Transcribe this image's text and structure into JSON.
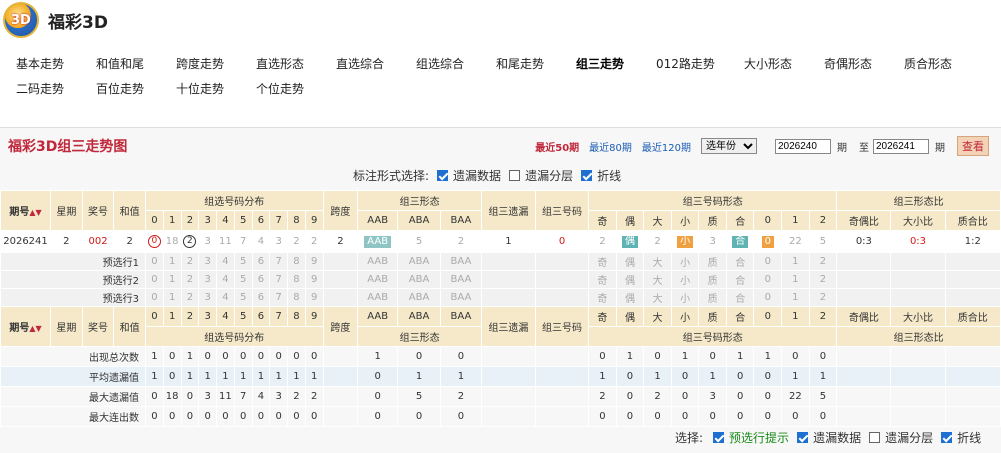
{
  "app": {
    "name": "福彩3D"
  },
  "nav": {
    "row1": [
      "基本走势",
      "和值和尾",
      "跨度走势",
      "直选形态",
      "直选综合",
      "组选综合",
      "和尾走势",
      "组三走势",
      "012路走势",
      "大小形态",
      "奇偶形态",
      "质合形态"
    ],
    "row2": [
      "二码走势",
      "百位走势",
      "十位走势",
      "个位走势"
    ],
    "active": "组三走势"
  },
  "panel": {
    "title": "福彩3D组三走势图",
    "period_links": [
      "最近50期",
      "最近80期",
      "最近120期"
    ],
    "year_select": "选年份",
    "from": "2026240",
    "from_unit": "期",
    "to_label": "至",
    "to": "2026241",
    "to_unit": "期",
    "search": "查看"
  },
  "marking": {
    "label": "标注形式选择:",
    "opts": [
      "遗漏数据",
      "遗漏分层",
      "折线"
    ]
  },
  "headers": {
    "issue": "期号",
    "week": "星期",
    "prize": "奖号",
    "sum": "和值",
    "dist": "组选号码分布",
    "span": "跨度",
    "shape": "组三形态",
    "miss": "组三遗漏",
    "code": "组三号码",
    "numshape": "组三号码形态",
    "ratio": "组三形态比",
    "digits": [
      "0",
      "1",
      "2",
      "3",
      "4",
      "5",
      "6",
      "7",
      "8",
      "9"
    ],
    "shapes": [
      "AAB",
      "ABA",
      "BAA"
    ],
    "numcols": [
      "奇",
      "偶",
      "大",
      "小",
      "质",
      "合",
      "0",
      "1",
      "2"
    ],
    "ratios": [
      "奇偶比",
      "大小比",
      "质合比"
    ]
  },
  "row": {
    "issue": "2026241",
    "week": "2",
    "prize": "002",
    "sum": "2",
    "dist": [
      "0",
      "18",
      "2",
      "3",
      "11",
      "7",
      "4",
      "3",
      "2",
      "2"
    ],
    "span": "2",
    "shape": [
      "AAB",
      "5",
      "2"
    ],
    "miss": "1",
    "code": "0",
    "num": [
      "2",
      "偶",
      "2",
      "小",
      "3",
      "合",
      "0",
      "22",
      "5"
    ],
    "ratios": [
      "0:3",
      "0:3",
      "1:2"
    ]
  },
  "pre": [
    "预选行1",
    "预选行2",
    "预选行3"
  ],
  "stats": [
    {
      "label": "出现总次数",
      "dist": [
        "1",
        "0",
        "1",
        "0",
        "0",
        "0",
        "0",
        "0",
        "0",
        "0"
      ],
      "shape": [
        "1",
        "0",
        "0"
      ],
      "num": [
        "0",
        "1",
        "0",
        "1",
        "0",
        "1",
        "1",
        "0",
        "0"
      ]
    },
    {
      "label": "平均遗漏值",
      "dist": [
        "1",
        "0",
        "1",
        "1",
        "1",
        "1",
        "1",
        "1",
        "1",
        "1"
      ],
      "shape": [
        "0",
        "1",
        "1"
      ],
      "num": [
        "1",
        "0",
        "1",
        "0",
        "1",
        "0",
        "0",
        "1",
        "1"
      ]
    },
    {
      "label": "最大遗漏值",
      "dist": [
        "0",
        "18",
        "0",
        "3",
        "11",
        "7",
        "4",
        "3",
        "2",
        "2"
      ],
      "shape": [
        "0",
        "5",
        "2"
      ],
      "num": [
        "2",
        "0",
        "2",
        "0",
        "3",
        "0",
        "0",
        "22",
        "5"
      ]
    },
    {
      "label": "最大连出数",
      "dist": [
        "0",
        "0",
        "0",
        "0",
        "0",
        "0",
        "0",
        "0",
        "0",
        "0"
      ],
      "shape": [
        "0",
        "0",
        "0"
      ],
      "num": [
        "0",
        "0",
        "0",
        "0",
        "0",
        "0",
        "0",
        "0",
        "0"
      ]
    }
  ],
  "footer": {
    "label": "选择:",
    "opts": [
      "预选行提示",
      "遗漏数据",
      "遗漏分层",
      "折线"
    ]
  }
}
